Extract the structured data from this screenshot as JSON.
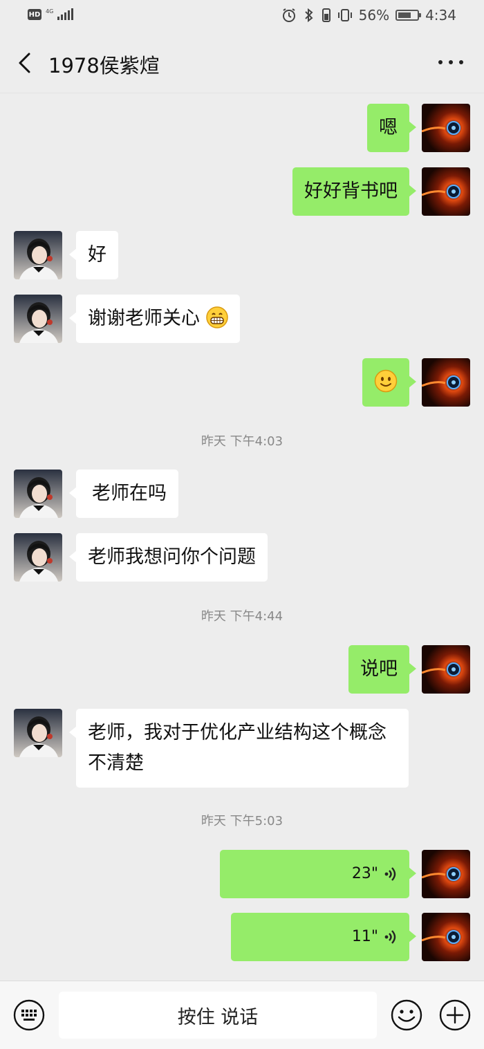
{
  "status": {
    "hd": "HD",
    "network": "4G",
    "battery_percent": "56%",
    "time": "4:34",
    "battery_level": 0.56
  },
  "header": {
    "title": "1978侯紫煊"
  },
  "messages": [
    {
      "side": "sent",
      "text": "嗯"
    },
    {
      "side": "sent",
      "text": "好好背书吧"
    },
    {
      "side": "received",
      "text": "好"
    },
    {
      "side": "received",
      "text": "谢谢老师关心",
      "emoji": "grin-emoji"
    },
    {
      "side": "sent",
      "emoji": "smile-emoji"
    },
    {
      "type": "time",
      "text": "昨天 下午4:03"
    },
    {
      "side": "received",
      "text": "老师在吗"
    },
    {
      "side": "received",
      "text": "老师我想问你个问题"
    },
    {
      "type": "time",
      "text": "昨天 下午4:44"
    },
    {
      "side": "sent",
      "text": "说吧"
    },
    {
      "side": "received",
      "text": "老师，我对于优化产业结构这个概念不清楚"
    },
    {
      "type": "time",
      "text": "昨天 下午5:03"
    },
    {
      "side": "sent",
      "type": "voice",
      "duration": "23\""
    },
    {
      "side": "sent",
      "type": "voice",
      "duration": "11\""
    }
  ],
  "input_bar": {
    "hold_to_talk": "按住 说话"
  }
}
